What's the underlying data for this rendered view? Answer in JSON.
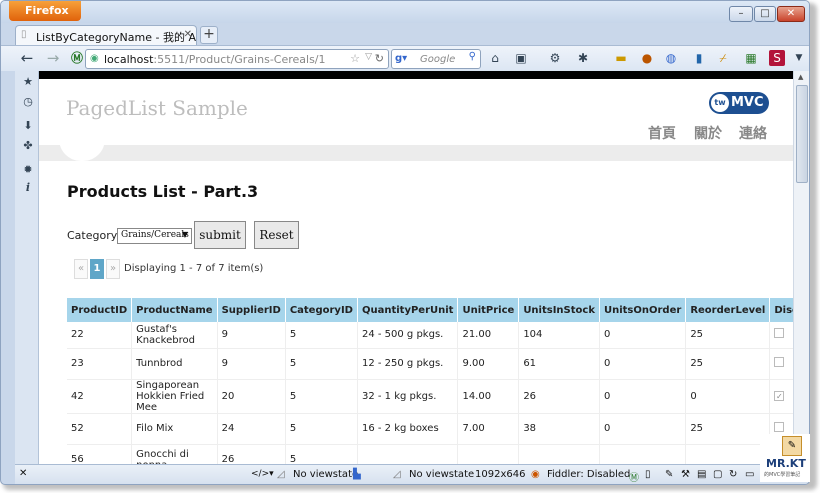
{
  "browser": {
    "app_button": "Firefox",
    "tab_title": "ListByCategoryName - 我的 ASP.NET ...",
    "url_host": "localhost",
    "url_rest": ":5511/Product/Grains-Cereals/1",
    "search_placeholder": "Google",
    "status": {
      "viewstate1": "No viewstate",
      "viewstate2": "No viewstate",
      "resolution": "1092x646",
      "fiddler": "Fiddler: Disabled"
    }
  },
  "site": {
    "title": "PagedList Sample",
    "logo_tw": "tw",
    "logo_text": "MVC",
    "menu": [
      "首頁",
      "關於",
      "連絡"
    ]
  },
  "page": {
    "heading": "Products List - Part.3",
    "category_label": "Category :",
    "category_value": "Grains/Cereals",
    "submit_label": "submit",
    "reset_label": "Reset",
    "pager": {
      "prev": "«",
      "current": "1",
      "next": "»",
      "text": "Displaying 1 - 7 of 7 item(s)"
    }
  },
  "table": {
    "columns": [
      "ProductID",
      "ProductName",
      "SupplierID",
      "CategoryID",
      "QuantityPerUnit",
      "UnitPrice",
      "UnitsInStock",
      "UnitsOnOrder",
      "ReorderLevel",
      "Discontinued"
    ],
    "rows": [
      [
        "22",
        "Gustaf's Knackebrod",
        "9",
        "5",
        "24 - 500 g pkgs.",
        "21.00",
        "104",
        "0",
        "25",
        "false"
      ],
      [
        "23",
        "Tunnbrod",
        "9",
        "5",
        "12 - 250 g pkgs.",
        "9.00",
        "61",
        "0",
        "25",
        "false"
      ],
      [
        "42",
        "Singaporean Hokkien Fried Mee",
        "20",
        "5",
        "32 - 1 kg pkgs.",
        "14.00",
        "26",
        "0",
        "0",
        "true"
      ],
      [
        "52",
        "Filo Mix",
        "24",
        "5",
        "16 - 2 kg boxes",
        "7.00",
        "38",
        "0",
        "25",
        "false"
      ],
      [
        "56",
        "Gnocchi di nonna",
        "26",
        "5",
        "",
        "",
        "",
        "",
        "",
        ""
      ]
    ]
  },
  "watermark": {
    "title": "MR.KT",
    "subtitle": "的MVC學習筆記"
  }
}
